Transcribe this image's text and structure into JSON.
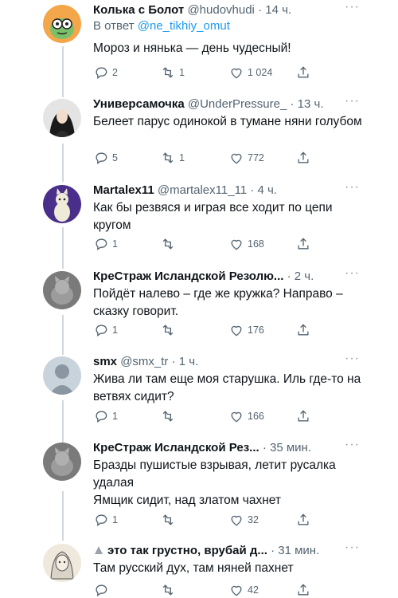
{
  "tweets": [
    {
      "name": "Колька с Болот",
      "handle": "@hudovhudi",
      "time": "14 ч.",
      "reply_prefix": "В ответ",
      "reply_mention": "@ne_tikhiy_omut",
      "text": "Мороз и нянька — день чудесный!",
      "replies": "2",
      "retweets": "1",
      "likes": "1 024"
    },
    {
      "name": "Универсамочка",
      "handle": "@UnderPressure_",
      "time": "13 ч.",
      "text": "Белеет парус одинокой в тумане няни голубом",
      "replies": "5",
      "retweets": "1",
      "likes": "772"
    },
    {
      "name": "Martalex11",
      "handle": "@martalex11_11",
      "time": "4 ч.",
      "text": "Как бы резвяся и играя все ходит по цепи кругом",
      "replies": "1",
      "retweets": "",
      "likes": "168"
    },
    {
      "name": "КреСтраж Исландской Резолю...",
      "handle": "",
      "time": "2 ч.",
      "text": "Пойдёт налево – где же кружка? Направо – сказку говорит.",
      "replies": "1",
      "retweets": "",
      "likes": "176"
    },
    {
      "name": "smx",
      "handle": "@smx_tr",
      "time": "1 ч.",
      "text": "Жива ли там еще моя старушка. Иль где-то на ветвях сидит?",
      "replies": "1",
      "retweets": "",
      "likes": "166"
    },
    {
      "name": "КреСтраж Исландской Рез...",
      "handle": "",
      "time": "35 мин.",
      "text": "Бразды пушистые взрывая, летит русалка удалая\nЯмщик сидит, над златом чахнет",
      "replies": "1",
      "retweets": "",
      "likes": "32"
    },
    {
      "name": "это так грустно, врубай д...",
      "handle": "",
      "time": "31 мин.",
      "text": "Там русский дух, там няней пахнет",
      "replies": "",
      "retweets": "",
      "likes": "42"
    }
  ],
  "more_glyph": "···",
  "separator": "·",
  "colors": {
    "accent": "#1d9bf0",
    "secondary": "#536471",
    "line": "#cfd9de"
  }
}
